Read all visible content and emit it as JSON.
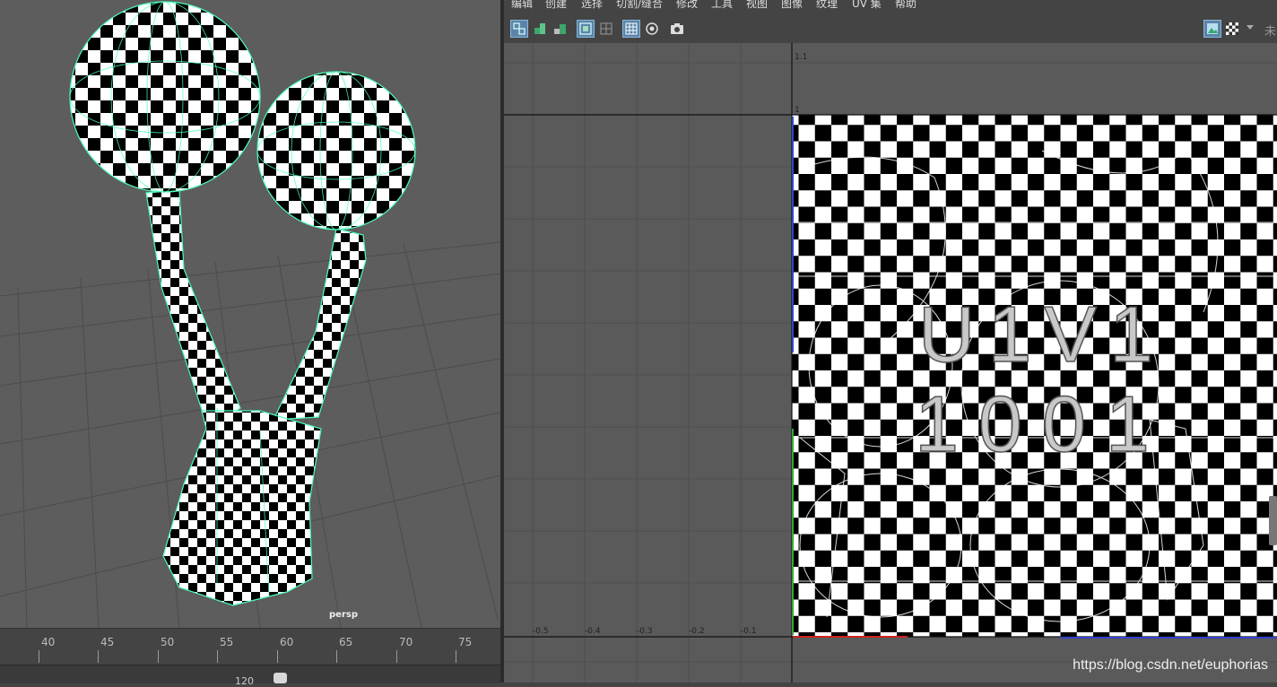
{
  "uv_menu": [
    "编辑",
    "创建",
    "选择",
    "切割/缝合",
    "修改",
    "工具",
    "视图",
    "图像",
    "纹理",
    "UV 集",
    "帮助"
  ],
  "toolbar_right_text": "未",
  "viewport": {
    "camera_label": "persp"
  },
  "timeline": {
    "ticks": [
      "40",
      "45",
      "50",
      "55",
      "60",
      "65",
      "70",
      "75"
    ],
    "range_end": "120"
  },
  "uv_axes": {
    "u_ticks": [
      "-0.5",
      "-0.4",
      "-0.3",
      "-0.2",
      "-0.1"
    ],
    "v_ticks": [
      "1.1",
      "1"
    ]
  },
  "uv_tile": {
    "line1": "U1V1",
    "line2": "1001"
  },
  "watermark": "https://blog.csdn.net/euphorias",
  "colors": {
    "wire": "#4dffb8",
    "viewport_bg": "#5d5d5d",
    "uv_bg": "#5a5a5a",
    "active_btn": "#5a85a8"
  }
}
